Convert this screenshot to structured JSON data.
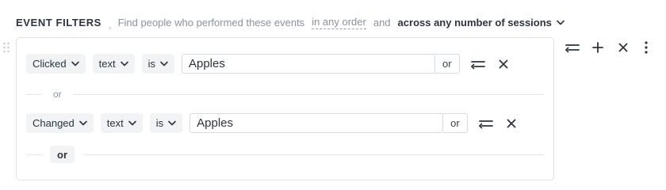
{
  "header": {
    "title": "EVENT FILTERS",
    "dot": ".",
    "description": "Find people who performed these events",
    "order": "in any order",
    "and": "and",
    "sessions": "across any number of sessions"
  },
  "filters": [
    {
      "event": "Clicked",
      "attribute": "text",
      "operator": "is",
      "value": "Apples",
      "or_label": "or"
    },
    {
      "event": "Changed",
      "attribute": "text",
      "operator": "is",
      "value": "Apples",
      "or_label": "or"
    }
  ],
  "separator": {
    "label": "or"
  },
  "add_or": {
    "label": "or"
  },
  "icons": {
    "chevron": "chevron-down-icon",
    "filter_row_action": "filter-lines-icon",
    "remove": "close-icon",
    "add": "plus-icon",
    "more": "vertical-dots-icon",
    "drag": "drag-handle-icon"
  },
  "colors": {
    "text": "#2b3440",
    "muted": "#8a939e",
    "pill_bg": "#f1f3f5",
    "border": "#dfe3e8"
  }
}
